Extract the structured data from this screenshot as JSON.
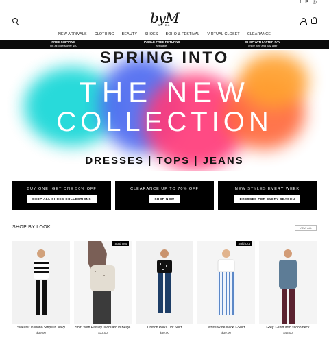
{
  "social": [
    "f",
    "P",
    "◎"
  ],
  "logo": {
    "mark": "byM",
    "sub": "AVIDA"
  },
  "nav": [
    "NEW ARRIVALS",
    "CLOTHING",
    "BEAUTY",
    "SHOES",
    "BOHO & FESTIVAL",
    "VIRTUAL CLOSET",
    "CLEARANCE"
  ],
  "promo": [
    {
      "title": "FREE SHIPPING",
      "sub": "On all orders over $50"
    },
    {
      "title": "HASSLE-FREE RETURNS",
      "sub": "Available"
    },
    {
      "title": "SHOP WITH AFTER PAY",
      "sub": "enjoy now and pay later"
    }
  ],
  "hero": {
    "line1": "SPRING INTO",
    "line2": "THE NEW",
    "line3": "COLLECTION",
    "line4": "DRESSES | TOPS | JEANS"
  },
  "ctas": [
    {
      "title": "BUY ONE, GET ONE 50% OFF",
      "button": "SHOP ALL SHOES COLLECTIONS"
    },
    {
      "title": "CLEARANCE UP TO 70% OFF",
      "button": "SHOP NOW"
    },
    {
      "title": "NEW STYLES EVERY WEEK",
      "button": "DRESSES FOR EVERY SEASON"
    }
  ],
  "shop_by_look": "SHOP BY LOOK",
  "view_all": "VIEW ALL",
  "products": [
    {
      "name": "Sweater in Mono Stripe in Navy",
      "price": "$39.00",
      "sold_out": ""
    },
    {
      "name": "Shirt With Paisley Jacquard in Beige",
      "price": "$33.00",
      "sold_out": "Sold Out"
    },
    {
      "name": "Chiffon Polka Dot Shirt",
      "price": "$30.00",
      "sold_out": ""
    },
    {
      "name": "White Wide Neck T-Shirt",
      "price": "$39.00",
      "sold_out": "Sold Out"
    },
    {
      "name": "Grey T-shirt with scoop neck",
      "price": "$43.00",
      "sold_out": ""
    }
  ]
}
